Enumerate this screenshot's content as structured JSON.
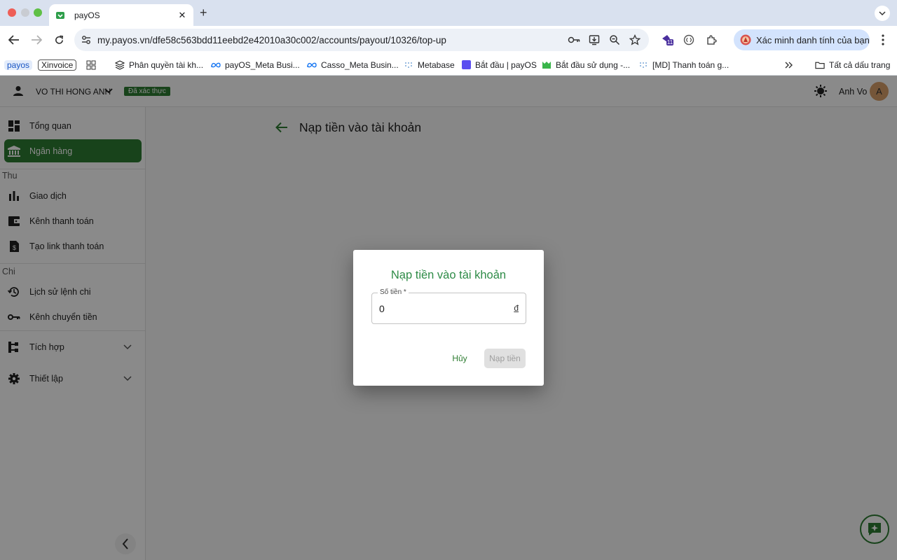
{
  "browser": {
    "tab_title": "payOS",
    "url": "my.payos.vn/dfe58c563bdd11eebd2e42010a30c002/accounts/payout/10326/top-up",
    "extension_badge": "11",
    "verify_chip": "Xác minh danh tính của bạn",
    "bookmarks": [
      "payos",
      "Xinvoice",
      "Phân quyền tài kh...",
      "payOS_Meta Busi...",
      "Casso_Meta Busin...",
      "Metabase",
      "Bắt đầu | payOS",
      "Bắt đầu sử dụng -...",
      "[MD] Thanh toán g..."
    ],
    "all_bookmarks": "Tất cả dấu trang"
  },
  "header": {
    "account_name": "VO THI HONG ANH",
    "verified_badge": "Đã xác thực",
    "user_name": "Anh Vo",
    "avatar_letter": "A"
  },
  "sidebar": {
    "items_top": [
      "Tổng quan",
      "Ngân hàng"
    ],
    "section_thu": "Thu",
    "items_thu": [
      "Giao dịch",
      "Kênh thanh toán",
      "Tạo link thanh toán"
    ],
    "section_chi": "Chi",
    "items_chi": [
      "Lịch sử lệnh chi",
      "Kênh chuyển tiền"
    ],
    "items_bottom": [
      "Tích hợp",
      "Thiết lập"
    ]
  },
  "page": {
    "title": "Nạp tiền vào tài khoản"
  },
  "dialog": {
    "title": "Nạp tiền vào tài khoản",
    "amount_label": "Số tiền *",
    "amount_value": "0",
    "currency": "đ",
    "cancel_label": "Hủy",
    "submit_label": "Nạp tiền"
  },
  "colors": {
    "brand_green": "#2e7d32",
    "dialog_title": "#2e8b47"
  }
}
